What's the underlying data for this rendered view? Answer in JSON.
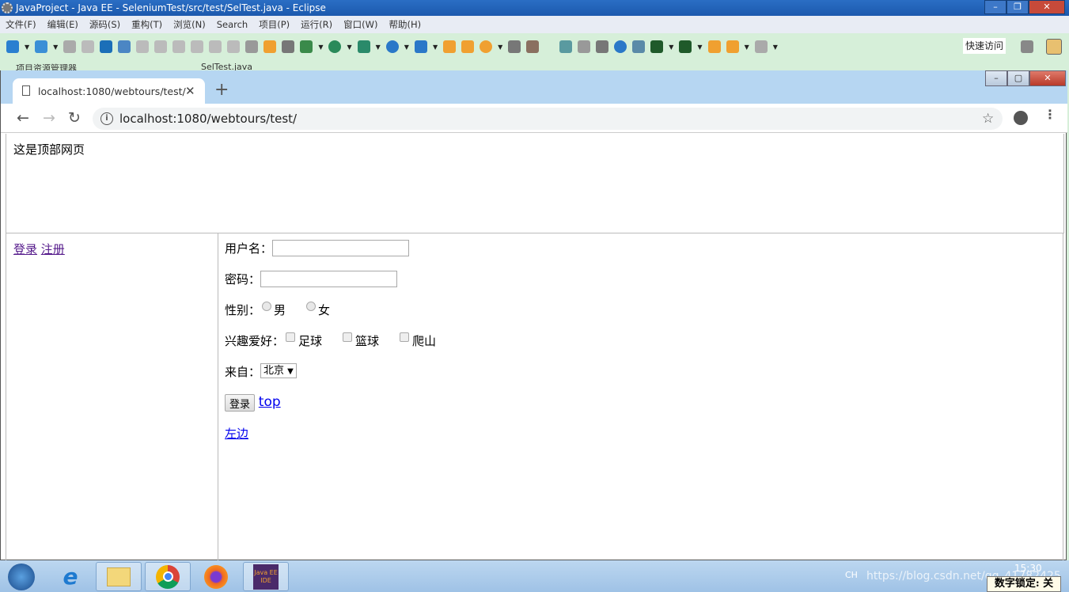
{
  "eclipse": {
    "title": "JavaProject  -  Java EE  -  SeleniumTest/src/test/SelTest.java  -  Eclipse",
    "menu": [
      "文件(F)",
      "编辑(E)",
      "源码(S)",
      "重构(T)",
      "浏览(N)",
      "Search",
      "项目(P)",
      "运行(R)",
      "窗口(W)",
      "帮助(H)"
    ],
    "quick_access": "快速访问",
    "view_tabs": [
      "项目资源管理器",
      "SelTest.java"
    ]
  },
  "browser": {
    "tab_title": "localhost:1080/webtours/test/",
    "url": "localhost:1080/webtours/test/"
  },
  "page": {
    "top_text": "这是顶部网页",
    "left_links": [
      "登录",
      "注册"
    ],
    "form": {
      "username_label": "用户名：",
      "username_value": "",
      "password_label": "密码：",
      "password_value": "",
      "gender_label": "性别：",
      "gender_options": [
        "男",
        "女"
      ],
      "hobby_label": "兴趣爱好：",
      "hobby_options": [
        "足球",
        "篮球",
        "爬山"
      ],
      "from_label": "来自：",
      "from_selected": "北京",
      "login_button": "登录",
      "top_link": "top",
      "left_link": "左边"
    }
  },
  "taskbar": {
    "apps": [
      "start",
      "internet-explorer",
      "file-explorer",
      "chrome",
      "firefox",
      "java-ee-ide"
    ],
    "java_icon_text": "Java EE IDE",
    "lang": "CH",
    "clock": "15:30",
    "watermark": "https://blog.csdn.net/qq_41782425",
    "numlock": "数字锁定: 关"
  }
}
